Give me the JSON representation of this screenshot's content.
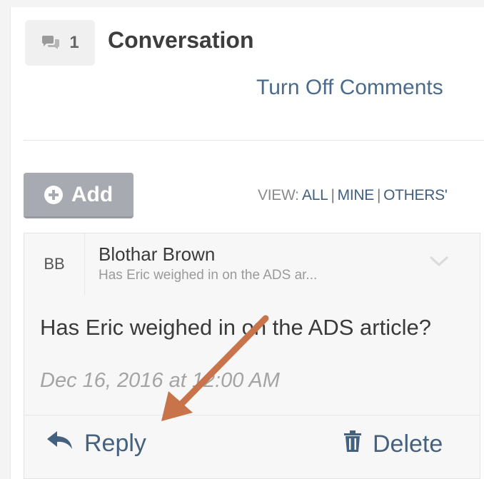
{
  "header": {
    "comment_count": "1",
    "title": "Conversation",
    "turn_off_label": "Turn Off Comments"
  },
  "toolbar": {
    "add_label": "Add",
    "view_prefix": "VIEW:",
    "view_options": [
      "ALL",
      "MINE",
      "OTHERS'"
    ]
  },
  "comment": {
    "initials": "BB",
    "author": "Blothar Brown",
    "snippet": "Has Eric weighed in on the ADS ar...",
    "body": "Has Eric weighed in on the ADS article?",
    "timestamp": "Dec 16, 2016 at 12:00 AM",
    "reply_label": "Reply",
    "delete_label": "Delete"
  },
  "colors": {
    "link": "#44627f",
    "annotation_arrow": "#c8734a",
    "add_button": "#a7abb1"
  },
  "icons": [
    "comment-bubbles-icon",
    "plus-circle-icon",
    "chevron-down-icon",
    "reply-arrow-icon",
    "trash-icon"
  ]
}
